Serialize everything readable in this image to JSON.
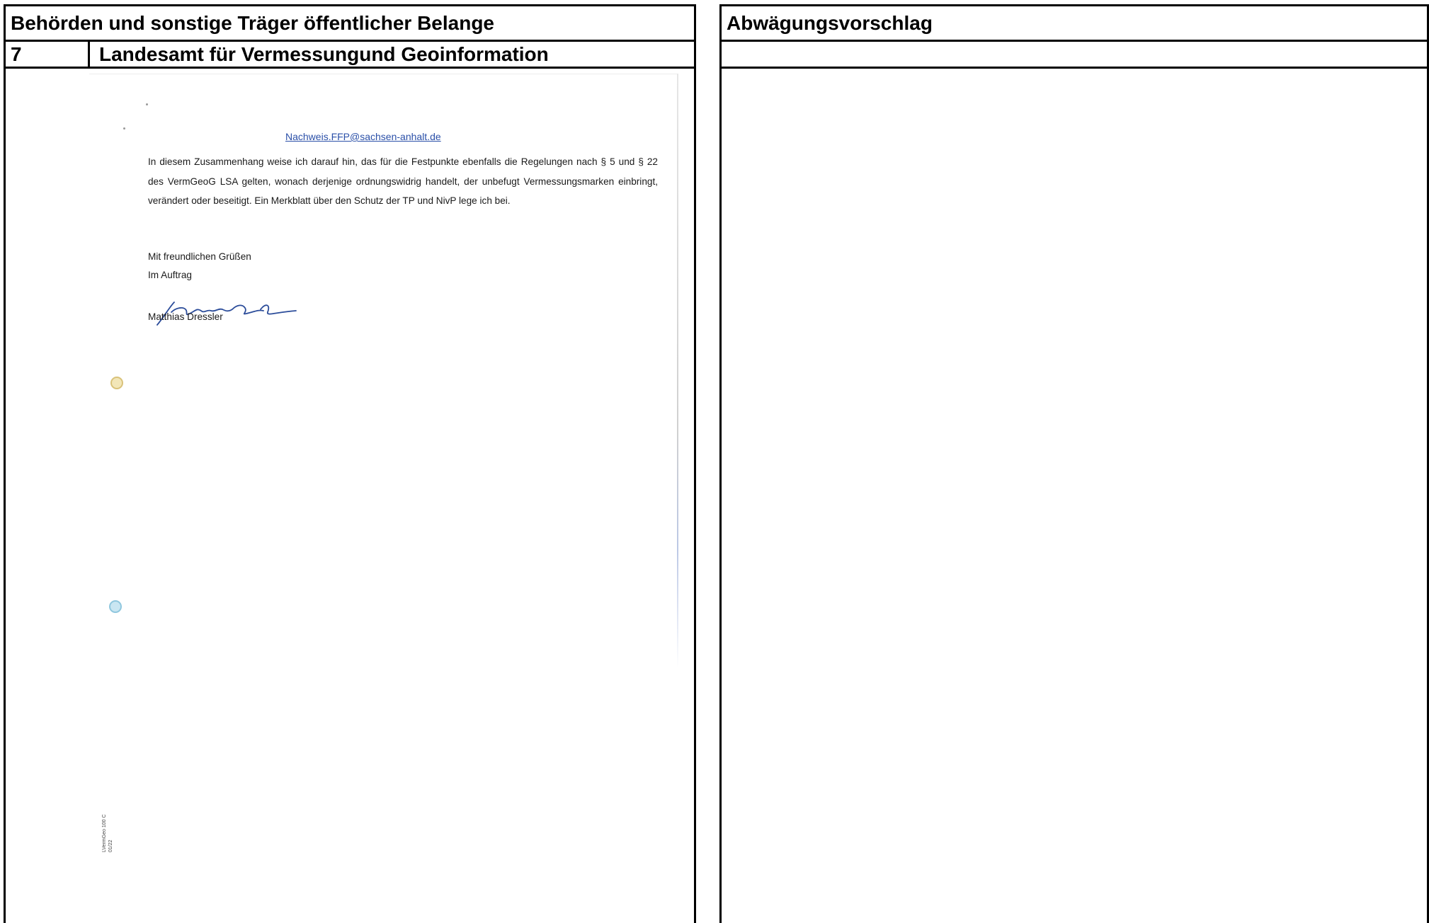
{
  "left_panel": {
    "header": "Behörden und sonstige Träger öffentlicher Belange",
    "row_number": "7",
    "row_title": "Landesamt für Vermessungund Geoinformation"
  },
  "right_panel": {
    "header": "Abwägungsvorschlag",
    "row_title": ""
  },
  "letter": {
    "email": "Nachweis.FFP@sachsen-anhalt.de",
    "paragraph": "In diesem Zusammenhang weise ich darauf hin, das für die Festpunkte ebenfalls die Regelungen nach § 5 und § 22 des VermGeoG LSA gelten, wonach derjenige ordnungswidrig handelt, der unbefugt Vermessungsmarken einbringt, verändert oder beseitigt. Ein Merkblatt über den Schutz der TP und NivP lege ich bei.",
    "closing": "Mit freundlichen Grüßen",
    "closing_2": "Im Auftrag",
    "signer": "Matthias Dressler",
    "form_code": "LVermGeo 100 C",
    "form_date": "01/22"
  }
}
